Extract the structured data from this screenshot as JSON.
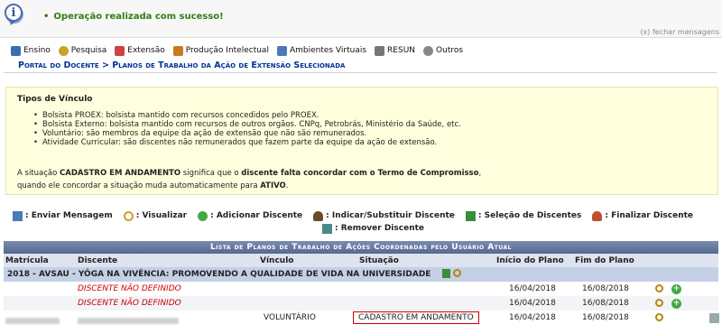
{
  "message": {
    "success": "Operação realizada com sucesso!",
    "close": "(x) fechar mensagens"
  },
  "menu": [
    {
      "label": "Ensino",
      "icon": "books-icon",
      "color": "#3b6db3"
    },
    {
      "label": "Pesquisa",
      "icon": "magnifier-icon",
      "color": "#c9a227"
    },
    {
      "label": "Extensão",
      "icon": "heart-hands-icon",
      "color": "#d24040"
    },
    {
      "label": "Produção Intelectual",
      "icon": "book-icon",
      "color": "#c97a1e"
    },
    {
      "label": "Ambientes Virtuais",
      "icon": "network-icon",
      "color": "#4a7ab8"
    },
    {
      "label": "RESUN",
      "icon": "handshake-icon",
      "color": "#777777"
    },
    {
      "label": "Outros",
      "icon": "gear-icon",
      "color": "#888888"
    }
  ],
  "breadcrumb": "Portal do Docente > Planos de Trabalho da Ação de Extensão Selecionada",
  "info": {
    "title": "Tipos de Vínculo",
    "items": [
      "Bolsista PROEX: bolsista mantido com recursos concedidos pelo PROEX.",
      "Bolsista Externo: bolsista mantido com recursos de outros orgãos. CNPq, Petrobrás, Ministério da Saúde, etc.",
      "Voluntário: são membros da equipe da ação de extensão que não são remunerados.",
      "Atividade Curricular: são discentes não remunerados que fazem parte da equipe da ação de extensão."
    ],
    "situacao_line1_a": "A situação ",
    "situacao_line1_b": "CADASTRO EM ANDAMENTO",
    "situacao_line1_c": " significa que o ",
    "situacao_line1_d": "discente falta concordar com o Termo de Compromisso",
    "situacao_line1_e": ",",
    "situacao_line2_a": "quando ele concordar a situação muda automaticamente para ",
    "situacao_line2_b": "ATIVO",
    "situacao_line2_c": "."
  },
  "actions": [
    {
      "label": ": Enviar Mensagem",
      "icon": "send-message-icon",
      "color": "#4a7ab8"
    },
    {
      "label": ": Visualizar",
      "icon": "magnifier-icon",
      "color": "#c9a227"
    },
    {
      "label": ": Adicionar Discente",
      "icon": "add-icon",
      "color": "#45a845"
    },
    {
      "label": ": Indicar/Substituir Discente",
      "icon": "user-swap-icon",
      "color": "#6a4a2a"
    },
    {
      "label": ": Seleção de Discentes",
      "icon": "list-icon",
      "color": "#3c8c3c"
    },
    {
      "label": ": Finalizar Discente",
      "icon": "user-finish-icon",
      "color": "#c0502a"
    },
    {
      "label": ": Remover Discente",
      "icon": "trash-icon",
      "color": "#4a8a8a"
    }
  ],
  "table": {
    "caption": "Lista de Planos de Trabalho de Ações Coordenadas pelo Usuário Atual",
    "headers": {
      "matricula": "Matrícula",
      "discente": "Discente",
      "vinculo": "Vínculo",
      "situacao": "Situação",
      "inicio": "Início do Plano",
      "fim": "Fim do Plano"
    },
    "group": "2018 - AVSAU - YÔGA NA VIVÊNCIA: PROMOVENDO A QUALIDADE DE VIDA NA UNIVERSIDADE",
    "rows": [
      {
        "discente": "DISCENTE NÃO DEFINIDO",
        "vinculo": "",
        "situacao": "",
        "inicio": "16/04/2018",
        "fim": "16/08/2018"
      },
      {
        "discente": "DISCENTE NÃO DEFINIDO",
        "vinculo": "",
        "situacao": "",
        "inicio": "16/04/2018",
        "fim": "16/08/2018"
      },
      {
        "discente": "",
        "vinculo": "VOLUNTÁRIO",
        "situacao": "CADASTRO EM ANDAMENTO",
        "inicio": "16/04/2018",
        "fim": "16/08/2018"
      }
    ]
  }
}
